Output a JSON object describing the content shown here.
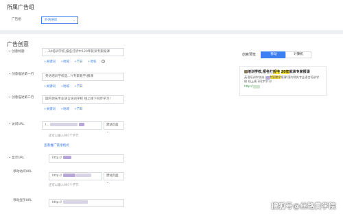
{
  "section1": {
    "title": "所属广告组",
    "adgroup_label": "广告组",
    "adgroup_value": "外语培训"
  },
  "section2": {
    "title": "广告创意",
    "headline": {
      "label": "创意标题",
      "value": "...2d培训学校,报名打折中120年就读专家报课",
      "links": [
        "+关键词",
        "+地域",
        "+节日",
        "+地标"
      ],
      "info_icon": "help-circle-icon"
    },
    "desc1": {
      "label": "创意描述第一行",
      "value": "英语培训学校选...?(专家教学)报课",
      "links": [
        "+关键词",
        "+地域",
        "+节日"
      ]
    },
    "desc2": {
      "label": "创意描述第二行",
      "value": "国内领先专业语言培训学校 线上线下同步学习!",
      "links": [
        "+关键词",
        "+地域",
        "+节日"
      ]
    },
    "visit_url": {
      "label": "访问URL",
      "value": "I...",
      "dropdown": "建站页面",
      "hint": "还可以输入997个字节",
      "link": "查看推广链接格式"
    },
    "display_url": {
      "label": "显示URL",
      "value": "http://"
    },
    "mobile_visit_url": {
      "label": "移动访问URL",
      "value": "http://",
      "dropdown": "建站页面",
      "hint": "还可以输入997个字节"
    },
    "mobile_display_url": {
      "label": "移动显示URL",
      "value": "http://"
    }
  },
  "preview": {
    "label": "创意预览",
    "tabs": [
      "移动",
      "计算机"
    ],
    "active_tab": "移动",
    "title_pre": "培训学校,报名打",
    "title_hl1": "折中",
    "title_hl2": "20年",
    "title_post": "就读专家报课",
    "desc_pre": "英语培训学校选",
    "desc_hl": "专家教学",
    "desc_post": "报课 国内领先专业语言培训学校 线上线下同步学习!",
    "url": "http://"
  },
  "watermark": "搜狐号@丝路黄学院",
  "colors": {
    "accent": "#3c7ff0",
    "highlight": "#f9e04b",
    "url_green": "#2e9b3e",
    "bg": "#eef0f3"
  }
}
